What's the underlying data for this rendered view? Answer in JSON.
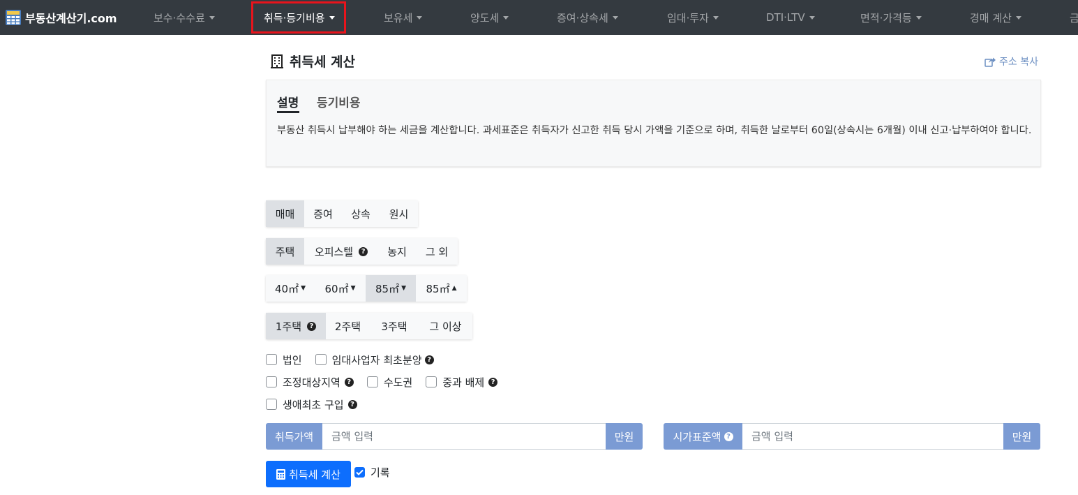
{
  "nav": {
    "brand": "부동산계산기.com",
    "items": [
      {
        "label": "보수·수수료",
        "active": false
      },
      {
        "label": "취득·등기비용",
        "active": true
      },
      {
        "label": "보유세",
        "active": false
      },
      {
        "label": "양도세",
        "active": false
      },
      {
        "label": "증여·상속세",
        "active": false
      },
      {
        "label": "임대·투자",
        "active": false
      },
      {
        "label": "DTI·LTV",
        "active": false
      },
      {
        "label": "면적·가격등",
        "active": false
      },
      {
        "label": "경매 계산",
        "active": false
      },
      {
        "label": "금",
        "active": false
      }
    ]
  },
  "header": {
    "title": "취득세 계산",
    "copy_link": "주소 복사"
  },
  "info_card": {
    "tabs": [
      "설명",
      "등기비용"
    ],
    "active_tab": "설명",
    "description": "부동산 취득시 납부해야 하는 세금을 계산합니다. 과세표준은 취득자가 신고한 취득 당시 가액을 기준으로 하며, 취득한 날로부터 60일(상속시는 6개월) 이내 신고·납부하여야 합니다."
  },
  "acquisition_type": {
    "options": [
      "매매",
      "증여",
      "상속",
      "원시"
    ],
    "selected": "매매"
  },
  "property_type": {
    "options": [
      "주택",
      "오피스텔",
      "농지",
      "그 외"
    ],
    "selected": "주택"
  },
  "area": {
    "options": [
      "40㎡",
      "60㎡",
      "85㎡",
      "85㎡"
    ],
    "selected_index": 2
  },
  "house_count": {
    "options": [
      "1주택",
      "2주택",
      "3주택",
      "그 이상"
    ],
    "selected": "1주택"
  },
  "checkboxes": {
    "corporation": {
      "label": "법인",
      "checked": false
    },
    "rental_first_sale": {
      "label": "임대사업자 최초분양",
      "checked": false
    },
    "regulated_area": {
      "label": "조정대상지역",
      "checked": false
    },
    "capital_area": {
      "label": "수도권",
      "checked": false
    },
    "heavy_exclusion": {
      "label": "중과 배제",
      "checked": false
    },
    "first_home": {
      "label": "생애최초 구입",
      "checked": false
    }
  },
  "inputs": {
    "acquisition_price": {
      "label": "취득가액",
      "placeholder": "금액 입력",
      "unit": "만원",
      "value": ""
    },
    "standard_price": {
      "label": "시가표준액",
      "placeholder": "금액 입력",
      "unit": "만원",
      "value": ""
    }
  },
  "actions": {
    "calculate_label": "취득세 계산",
    "record_label": "기록",
    "record_checked": true
  },
  "colors": {
    "navbar": "#343a40",
    "highlight": "#e8141c",
    "input_addon": "#7b9bd4",
    "primary": "#0d6efd"
  }
}
